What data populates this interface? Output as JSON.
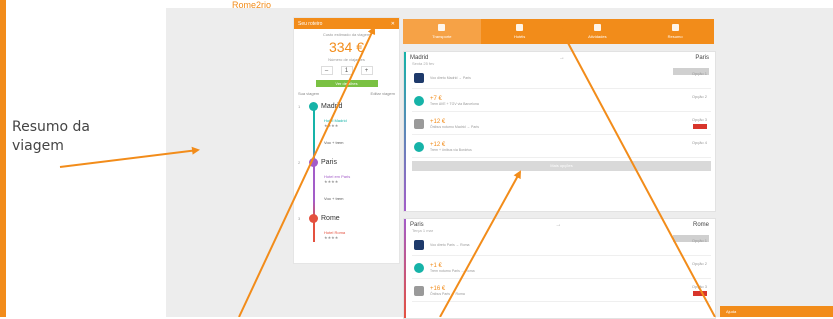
{
  "annotation": {
    "line1": "Resumo da",
    "line2": "viagem"
  },
  "brand": "Rome2rio",
  "colors": {
    "accent": "#f28c1a",
    "green": "#7ac143",
    "teal": "#16b3a8",
    "purple": "#a35dc8",
    "red": "#e4513f",
    "navy": "#1e3a6b"
  },
  "summary": {
    "title": "Seu roteiro",
    "caption": "Custo estimado da viagem",
    "total": "334 €",
    "subtitle": "Número de viajantes",
    "stepper": {
      "minus": "–",
      "value": "1",
      "plus": "+"
    },
    "button": "Ver detalhes",
    "link_left": "Sua viagem",
    "link_right": "Editar viagem",
    "stops": [
      {
        "num": "1",
        "name": "Madrid",
        "color": "#16b3a8"
      },
      {
        "num": "2",
        "name": "Paris",
        "color": "#a35dc8"
      },
      {
        "num": "3",
        "name": "Rome",
        "color": "#e4513f"
      }
    ],
    "legs": [
      {
        "title": "Hotel Madrid",
        "stars": "★★★★"
      },
      {
        "title": "Voo + trem",
        "stars": ""
      },
      {
        "title": "Hotel em Paris",
        "stars": "★★★★"
      },
      {
        "title": "Voo + trem",
        "stars": ""
      },
      {
        "title": "Hotel Roma",
        "stars": "★★★★"
      }
    ]
  },
  "tabs": [
    {
      "label": "Transporte",
      "icon": "plane-icon"
    },
    {
      "label": "Hotéis",
      "icon": "hotel-icon"
    },
    {
      "label": "Atividades",
      "icon": "activity-icon"
    },
    {
      "label": "Resumo",
      "icon": "document-icon"
    }
  ],
  "segments": [
    {
      "from": "Madrid",
      "to": "Paris",
      "date": "Sexta 25 fev",
      "options": [
        {
          "icon": "flight-icon",
          "price": "",
          "details": "Voo direto Madrid → Paris",
          "right": "Opção 1"
        },
        {
          "icon": "train-icon",
          "price": "+7 €",
          "details": "Trem AVE + TGV via Barcelona",
          "right": "Opção 2"
        },
        {
          "icon": "bus-icon",
          "price": "+12 €",
          "details": "Ônibus noturno Madrid → Paris",
          "right": "Opção 3"
        },
        {
          "icon": "train-icon",
          "price": "+12 €",
          "details": "Trem + ônibus via Bordéus",
          "right": "Opção 4"
        }
      ],
      "more": "Mais opções"
    },
    {
      "from": "Paris",
      "to": "Rome",
      "date": "Terça 1 mar",
      "options": [
        {
          "icon": "flight-icon",
          "price": "",
          "details": "Voo direto Paris → Roma",
          "right": "Opção 1"
        },
        {
          "icon": "train-icon",
          "price": "+1 €",
          "details": "Trem noturno Paris → Roma",
          "right": "Opção 2"
        },
        {
          "icon": "bus-icon",
          "price": "+16 €",
          "details": "Ônibus Paris → Roma",
          "right": "Opção 3"
        }
      ]
    }
  ],
  "chat": "Ajuda"
}
